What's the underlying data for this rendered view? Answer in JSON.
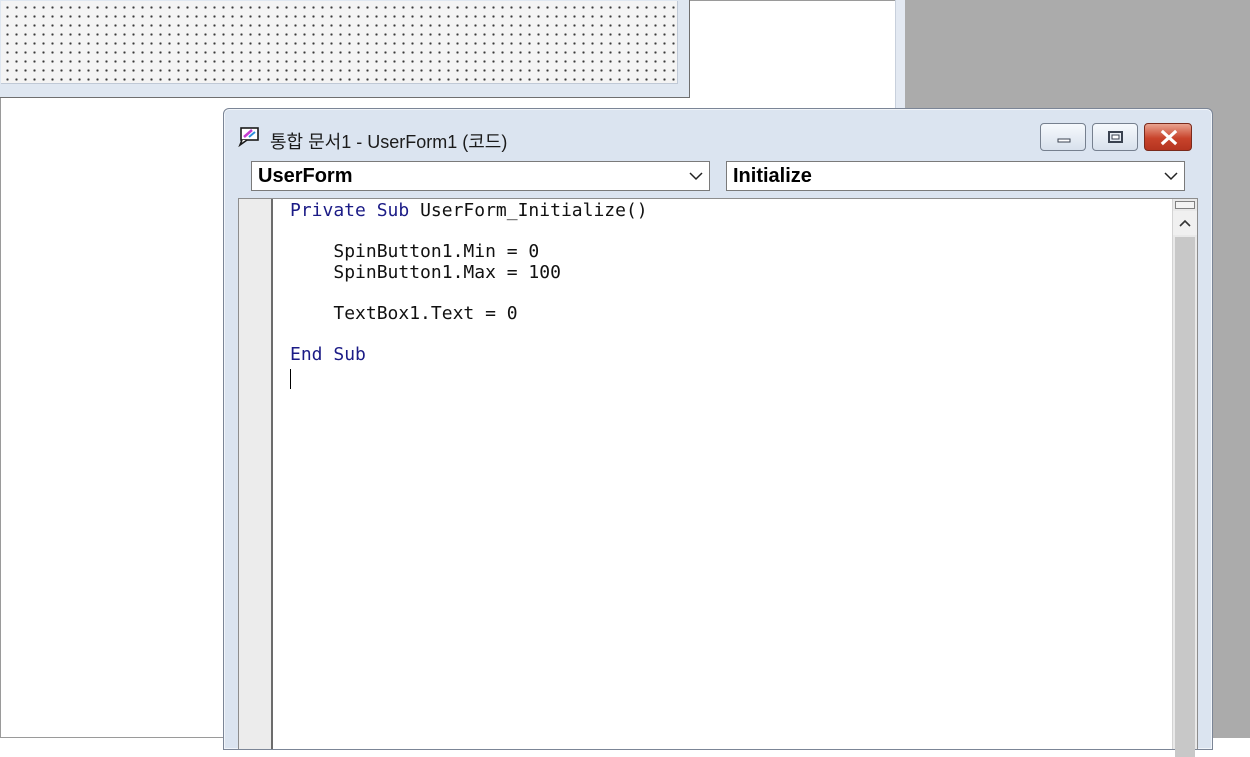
{
  "window": {
    "title": "통합 문서1 - UserForm1 (코드)",
    "icon": "code-window-icon"
  },
  "controls": {
    "minimize": "minimize-icon",
    "maximize": "maximize-icon",
    "close": "close-icon"
  },
  "object_combo": {
    "value": "UserForm"
  },
  "procedure_combo": {
    "value": "Initialize"
  },
  "code": {
    "line1_kw1": "Private",
    "line1_kw2": "Sub",
    "line1_rest": "UserForm_Initialize()",
    "line3": "SpinButton1.Min = 0",
    "line4": "SpinButton1.Max = 100",
    "line6": "TextBox1.Text = 0",
    "line8_kw1": "End",
    "line8_kw2": "Sub"
  },
  "colors": {
    "keyword": "#1b1b86",
    "close_button": "#c8432b",
    "mdi_background": "#ababab"
  }
}
